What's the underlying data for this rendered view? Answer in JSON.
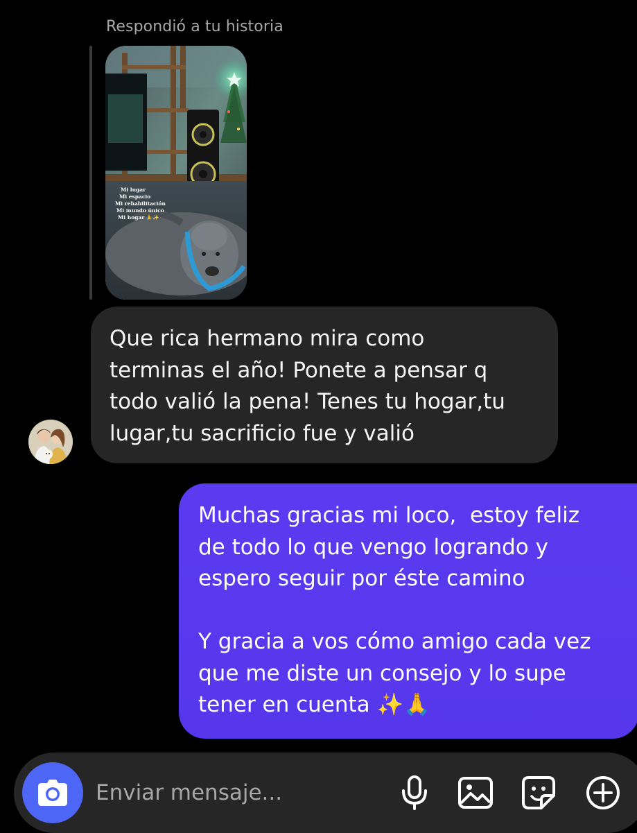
{
  "story_reply": {
    "label": "Respondió a tu historia",
    "thumbnail_caption": [
      "Mi lugar",
      "Mi espacio",
      "Mi rehabilitación",
      "Mi mundo único",
      "Mi hogar 🙏✨"
    ]
  },
  "messages": [
    {
      "direction": "received",
      "text": "Que rica hermano mira como\nterminas el año! Ponete a pensar q\ntodo valió la pena! Tenes tu hogar,tu\nlugar,tu sacrificio fue y valió"
    },
    {
      "direction": "sent",
      "text": "Muchas gracias mi loco,  estoy feliz\nde todo lo que vengo logrando y\nespero seguir por éste camino\n\nY gracia a vos cómo amigo cada vez\nque me diste un consejo y lo supe\ntener en cuenta ✨🙏"
    }
  ],
  "composer": {
    "placeholder": "Enviar mensaje...",
    "value": "",
    "icons": [
      "camera-icon",
      "microphone-icon",
      "gallery-icon",
      "sticker-icon",
      "plus-icon"
    ]
  },
  "colors": {
    "background": "#000000",
    "received_bubble": "#262626",
    "sent_bubble": "#5a38f0",
    "camera_button": "#4e66f5",
    "secondary_text": "#a8a8a8"
  }
}
